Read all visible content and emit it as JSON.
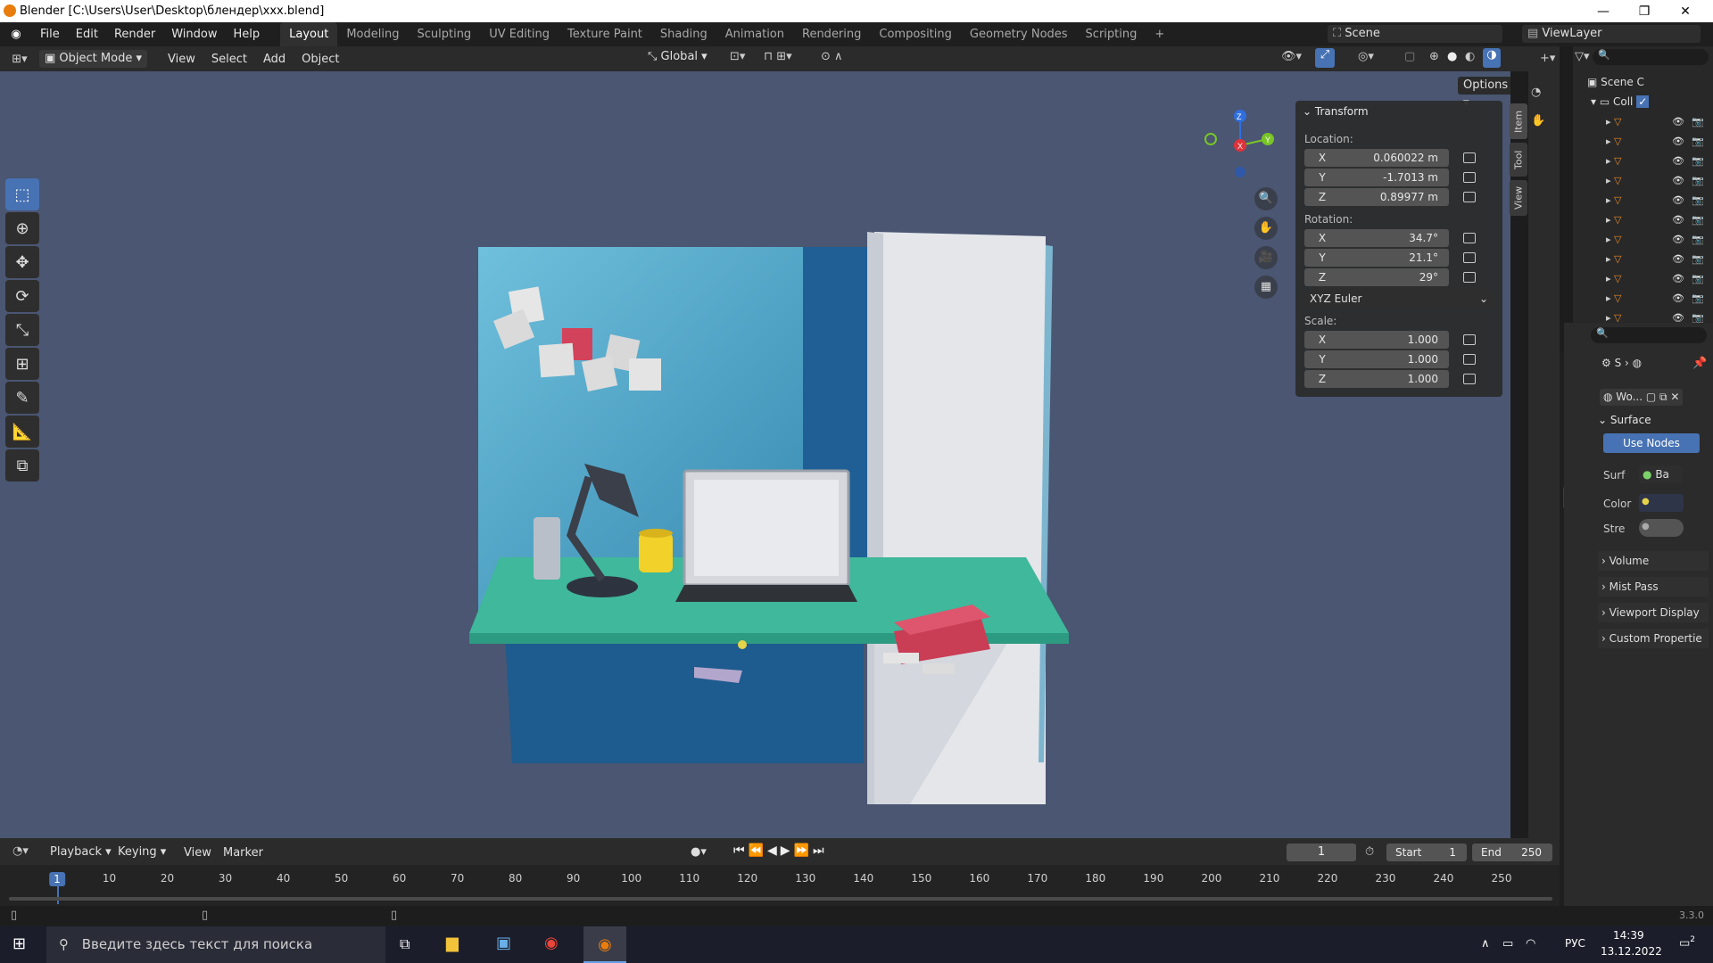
{
  "window": {
    "title": "Blender [C:\\Users\\User\\Desktop\\блендер\\xxx.blend]"
  },
  "menu": [
    "File",
    "Edit",
    "Render",
    "Window",
    "Help"
  ],
  "workspaces": [
    "Layout",
    "Modeling",
    "Sculpting",
    "UV Editing",
    "Texture Paint",
    "Shading",
    "Animation",
    "Rendering",
    "Compositing",
    "Geometry Nodes",
    "Scripting"
  ],
  "scene": {
    "name": "Scene",
    "view_layer": "ViewLayer"
  },
  "viewport_header": {
    "mode": "Object Mode",
    "menus": [
      "View",
      "Select",
      "Add",
      "Object"
    ],
    "orientation": "Global",
    "options": "Options"
  },
  "npanel": {
    "tabs": [
      "Item",
      "Tool",
      "View"
    ],
    "section": "Transform",
    "location_label": "Location:",
    "location": [
      {
        "axis": "X",
        "value": "0.060022 m"
      },
      {
        "axis": "Y",
        "value": "-1.7013 m"
      },
      {
        "axis": "Z",
        "value": "0.89977 m"
      }
    ],
    "rotation_label": "Rotation:",
    "rotation": [
      {
        "axis": "X",
        "value": "34.7°"
      },
      {
        "axis": "Y",
        "value": "21.1°"
      },
      {
        "axis": "Z",
        "value": "29°"
      }
    ],
    "rotation_mode": "XYZ Euler",
    "scale_label": "Scale:",
    "scale": [
      {
        "axis": "X",
        "value": "1.000"
      },
      {
        "axis": "Y",
        "value": "1.000"
      },
      {
        "axis": "Z",
        "value": "1.000"
      }
    ]
  },
  "gizmo": {
    "z": "Z",
    "y": "Y",
    "x": "X"
  },
  "outliner": {
    "root": "Scene C",
    "collection": "Coll"
  },
  "properties": {
    "breadcrumb": "S",
    "world_name": "Wo...",
    "surface_label": "Surface",
    "use_nodes": "Use Nodes",
    "surf_label": "Surf",
    "surf_value": "Ba",
    "color_label": "Color",
    "strength_label": "Stre",
    "panels": [
      "Volume",
      "Mist Pass",
      "Viewport Display",
      "Custom Propertie"
    ]
  },
  "timeline": {
    "menus": [
      "Playback",
      "Keying",
      "View",
      "Marker"
    ],
    "current_frame": "1",
    "start_label": "Start",
    "start": "1",
    "end_label": "End",
    "end": "250",
    "ticks": [
      "1",
      "10",
      "20",
      "30",
      "40",
      "50",
      "60",
      "70",
      "80",
      "90",
      "100",
      "110",
      "120",
      "130",
      "140",
      "150",
      "160",
      "170",
      "180",
      "190",
      "200",
      "210",
      "220",
      "230",
      "240",
      "250"
    ]
  },
  "version": "3.3.0",
  "taskbar": {
    "search_placeholder": "Введите здесь текст для поиска",
    "lang": "РУС",
    "time": "14:39",
    "date": "13.12.2022",
    "notifications": "2"
  }
}
